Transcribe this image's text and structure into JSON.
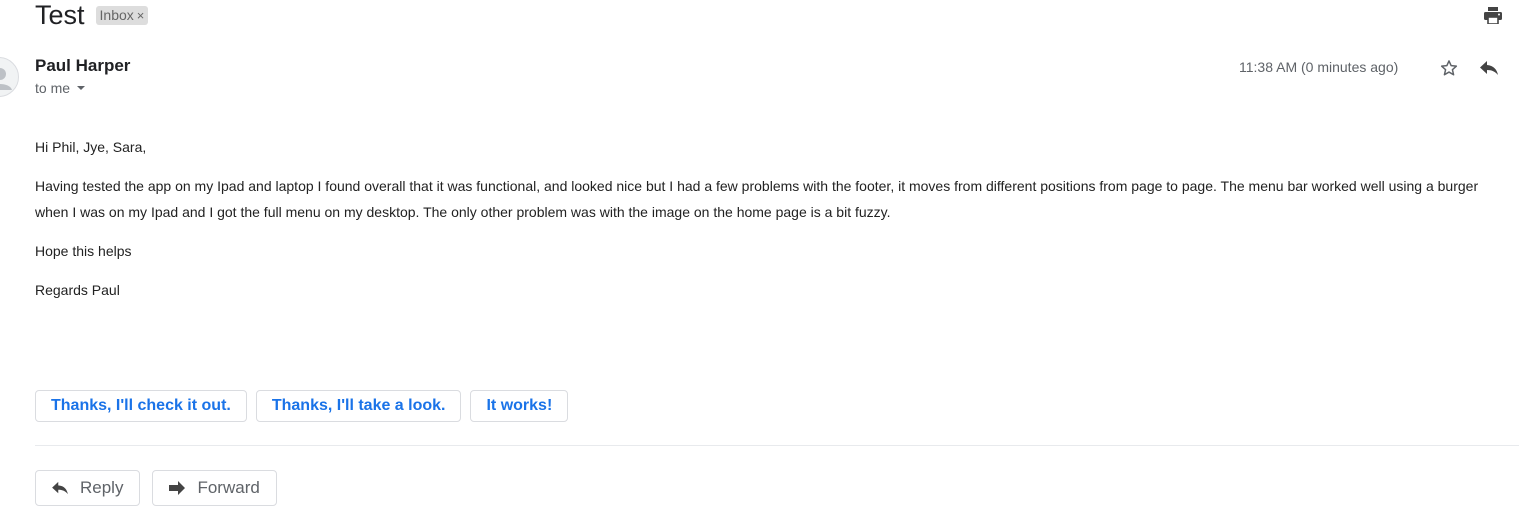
{
  "subject": "Test",
  "label": {
    "text": "Inbox",
    "remove_glyph": "×"
  },
  "icons": {
    "print": "print-icon",
    "avatar": "person-icon",
    "star": "star-outline-icon",
    "reply": "reply-icon",
    "forward": "forward-icon"
  },
  "message": {
    "sender": "Paul Harper",
    "recipient": "to me",
    "timestamp": "11:38 AM (0 minutes ago)",
    "body": [
      "Hi Phil, Jye, Sara,",
      "Having tested the app on my Ipad and laptop I found overall that it was functional, and looked nice but I had a few problems with the footer, it moves from different positions from page to page. The menu bar worked well using a burger when I was on my Ipad and I got the full menu on my desktop. The only other problem was with the image on the home page is a bit fuzzy.",
      "Hope this helps",
      "Regards Paul"
    ]
  },
  "smart_replies": [
    "Thanks, I'll check it out.",
    "Thanks, I'll take a look.",
    "It works!"
  ],
  "actions": {
    "reply_label": "Reply",
    "forward_label": "Forward"
  },
  "colors": {
    "accent": "#1a73e8",
    "muted": "#5f6368",
    "chip_bg": "#dddddd"
  }
}
